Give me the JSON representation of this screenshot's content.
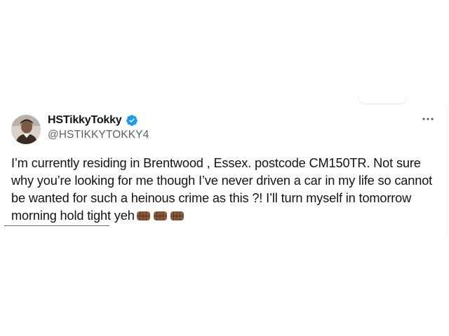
{
  "tweet": {
    "display_name": "HSTikkyTokky",
    "handle": "@HSTIKKYTOKKY4",
    "verified": true,
    "verified_color": "#1d9bf0",
    "more_icon": "more-horizontal-icon",
    "body_text": "I’m currently residing in Brentwood , Essex. postcode CM150TR.  Not sure why you’re looking for me though I’ve never driven a car in my life so cannot be wanted for such a heinous crime as this ?! I’ll turn myself in tomorrow morning hold tight yeh",
    "emojis": [
      "fist-icon",
      "fist-icon",
      "fist-icon"
    ],
    "emoji_color": "#8a5a3b"
  }
}
